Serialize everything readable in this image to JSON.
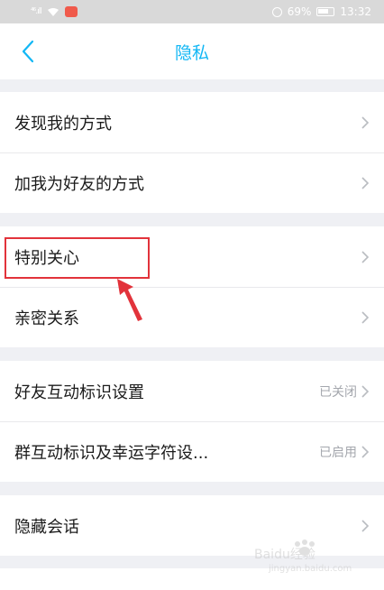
{
  "status_bar": {
    "signal": "⁴⁶.ıll",
    "battery_percent": "69%",
    "time": "13:32"
  },
  "header": {
    "title": "隐私"
  },
  "sections": [
    {
      "items": [
        {
          "label": "发现我的方式",
          "status": ""
        },
        {
          "label": "加我为好友的方式",
          "status": ""
        }
      ]
    },
    {
      "items": [
        {
          "label": "特别关心",
          "status": ""
        },
        {
          "label": "亲密关系",
          "status": ""
        }
      ]
    },
    {
      "items": [
        {
          "label": "好友互动标识设置",
          "status": "已关闭"
        },
        {
          "label": "群互动标识及幸运字符设...",
          "status": "已启用"
        }
      ]
    },
    {
      "items": [
        {
          "label": "隐藏会话",
          "status": ""
        }
      ]
    }
  ],
  "watermark": {
    "text": "Baidu经验",
    "subtext": "jingyan.baidu.com"
  },
  "colors": {
    "accent": "#12b7f5",
    "highlight": "#e2333b",
    "background": "#eff0f4"
  }
}
